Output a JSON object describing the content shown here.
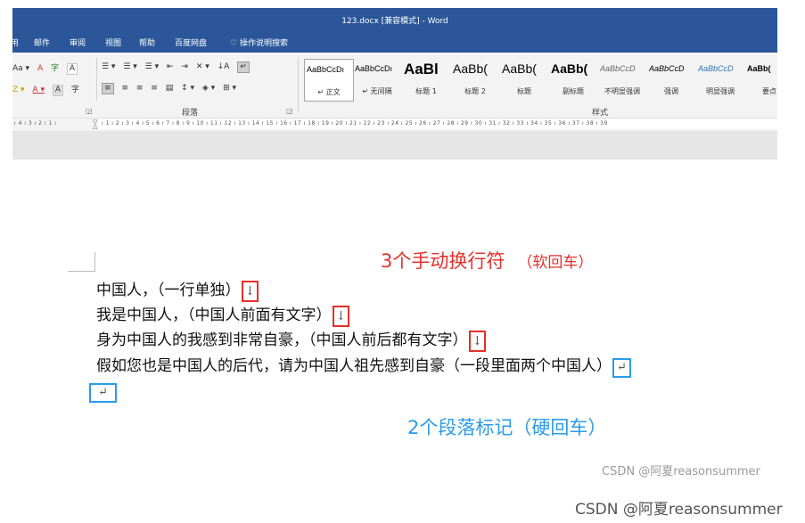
{
  "window": {
    "title": "123.docx [兼容模式] - Word"
  },
  "menu": {
    "items": [
      "用",
      "邮件",
      "审阅",
      "视图",
      "帮助",
      "百度网盘"
    ],
    "search_icon": "lightbulb-icon",
    "search_label": "操作说明搜索"
  },
  "ribbon": {
    "font_row1": [
      "Aa ▾",
      "A",
      "字",
      "A"
    ],
    "font_row2": [
      "Z ▾",
      "A ▾",
      "A",
      "字"
    ],
    "para_row1": [
      "☰ ▾",
      "☰ ▾",
      "☰ ▾",
      "⇤",
      "⇥",
      "✕ ▾",
      "↓A",
      "↵"
    ],
    "para_row2": [
      "≡",
      "≡",
      "≡",
      "≡",
      "▤",
      "↕ ▾",
      "◈ ▾",
      "⊞ ▾"
    ],
    "paragraph_group_label": "段落",
    "styles_group_label": "样式",
    "styles": [
      {
        "preview": "AaBbCcDı",
        "name": "↵ 正文",
        "selected": true
      },
      {
        "preview": "AaBbCcDı",
        "name": "↵ 无间隔",
        "selected": false
      },
      {
        "preview": "AaBl",
        "name": "标题 1",
        "selected": false
      },
      {
        "preview": "AaBb(",
        "name": "标题 2",
        "selected": false
      },
      {
        "preview": "AaBb(",
        "name": "标题",
        "selected": false
      },
      {
        "preview": "AaBb(",
        "name": "副标题",
        "selected": false
      },
      {
        "preview": "AaBbCcD",
        "name": "不明显强调",
        "selected": false
      },
      {
        "preview": "AaBbCcD",
        "name": "强调",
        "selected": false
      },
      {
        "preview": "AaBbCcD",
        "name": "明显强调",
        "selected": false
      },
      {
        "preview": "AaBb(",
        "name": "要点",
        "selected": false
      }
    ]
  },
  "ruler": {
    "left_marks": "ı 4 ı 3 ı 2 ı 1 ı",
    "right_marks": "ı 1 ı 2 ı 3 ı 4 ı 5 ı 6 ı 7 ı 8 ı 9 ı 10 ı 11 ı 12 ı 13 ı 14 ı 15 ı 16 ı 17 ı 18 ı 19 ı 20 ı 21 ı 22 ı 23 ı 24 ı 25 ı 26 ı 27 ı 28 ı 29 ı 30 ı 31 ı 32 ı 33 ı 34 ı 35 ı 36 ı 37 ı 38 ı 39"
  },
  "document": {
    "lines": [
      {
        "text": "中国人，（一行单独）",
        "mark": "↓",
        "box": "red"
      },
      {
        "text": "我是中国人，（中国人前面有文字）",
        "mark": "↓",
        "box": "red"
      },
      {
        "text": "身为中国人的我感到非常自豪，（中国人前后都有文字）",
        "mark": "↓",
        "box": "red"
      },
      {
        "text": "假如您也是中国人的后代，请为中国人祖先感到自豪（一段里面两个中国人）",
        "mark": "↵",
        "box": "blue"
      },
      {
        "text": "",
        "mark": "↵",
        "box": "blue"
      }
    ]
  },
  "annotations": {
    "red_main": "3个手动换行符",
    "red_sub": "（软回车）",
    "blue": "2个段落标记（硬回车）",
    "colors": {
      "red": "#e5302a",
      "blue": "#2b9be8"
    }
  },
  "watermark": {
    "small": "CSDN @阿夏reasonsummer",
    "large": "CSDN @阿夏reasonsummer"
  }
}
